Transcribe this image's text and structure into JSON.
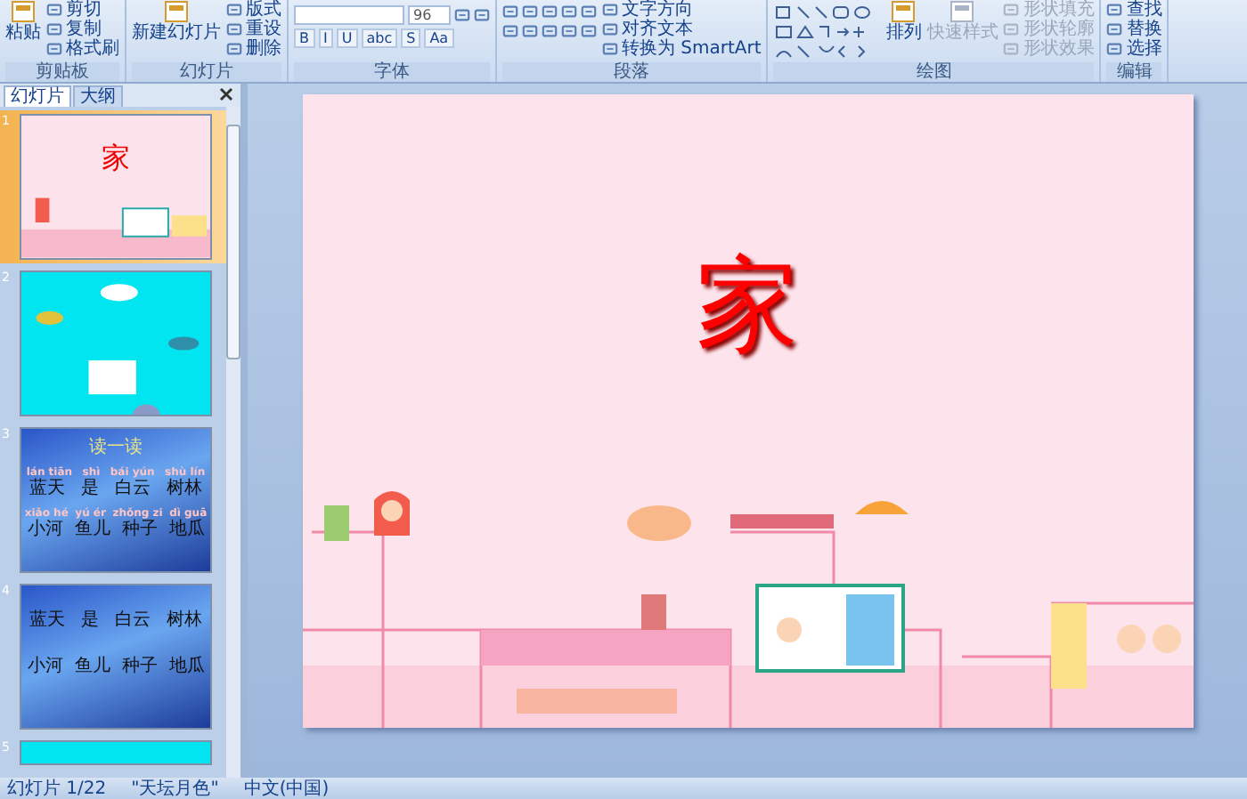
{
  "ribbon": {
    "groups": [
      {
        "kind": "clipboard",
        "label": "剪贴板",
        "large": [
          {
            "label": "粘贴",
            "disabled": false
          }
        ],
        "small": [
          {
            "label": "剪切",
            "disabled": false
          },
          {
            "label": "复制",
            "disabled": false
          },
          {
            "label": "格式刷",
            "disabled": false
          }
        ]
      },
      {
        "kind": "slides",
        "label": "幻灯片",
        "large": [
          {
            "label": "新建幻灯片",
            "disabled": false
          }
        ],
        "small": [
          {
            "label": "版式",
            "disabled": false
          },
          {
            "label": "重设",
            "disabled": false
          },
          {
            "label": "删除",
            "disabled": false
          }
        ]
      },
      {
        "kind": "font",
        "label": "字体",
        "font_size": "96",
        "format_buttons": [
          "B",
          "I",
          "U",
          "abc",
          "S",
          "Aa"
        ]
      },
      {
        "kind": "paragraph",
        "label": "段落",
        "small": [
          {
            "label": "文字方向",
            "disabled": false
          },
          {
            "label": "对齐文本",
            "disabled": false
          },
          {
            "label": "转换为 SmartArt",
            "disabled": false
          }
        ]
      },
      {
        "kind": "drawing",
        "label": "绘图",
        "large": [
          {
            "label": "排列",
            "disabled": false
          },
          {
            "label": "快速样式",
            "disabled": true
          }
        ],
        "small": [
          {
            "label": "形状填充",
            "disabled": true
          },
          {
            "label": "形状轮廓",
            "disabled": true
          },
          {
            "label": "形状效果",
            "disabled": true
          }
        ]
      },
      {
        "kind": "editing",
        "label": "编辑",
        "small": [
          {
            "label": "查找",
            "disabled": false
          },
          {
            "label": "替换",
            "disabled": false
          },
          {
            "label": "选择",
            "disabled": false
          }
        ]
      }
    ]
  },
  "panel": {
    "tabs": [
      {
        "label": "幻灯片",
        "selected": true
      },
      {
        "label": "大纲",
        "selected": false
      }
    ],
    "thumbnails": [
      {
        "number": "1",
        "selected": true,
        "kind": "title",
        "title": "家"
      },
      {
        "number": "2",
        "selected": false,
        "kind": "scene"
      },
      {
        "number": "3",
        "selected": false,
        "kind": "reading",
        "title": "读一读",
        "rows": [
          {
            "pinyin": [
              "lán tiān",
              "shì",
              "bái yún",
              "shù lín"
            ],
            "words": [
              "蓝天",
              "是",
              "白云",
              "树林"
            ]
          },
          {
            "pinyin": [
              "xiǎo hé",
              "yú ér",
              "zhǒng zi",
              "dì guā"
            ],
            "words": [
              "小河",
              "鱼儿",
              "种子",
              "地瓜"
            ]
          }
        ]
      },
      {
        "number": "4",
        "selected": false,
        "kind": "words",
        "rows": [
          {
            "words": [
              "蓝天",
              "是",
              "白云",
              "树林"
            ]
          },
          {
            "words": [
              "小河",
              "鱼儿",
              "种子",
              "地瓜"
            ]
          }
        ]
      },
      {
        "number": "5",
        "selected": false,
        "kind": "partial"
      }
    ]
  },
  "slide": {
    "title": "家"
  },
  "status_bar": {
    "items": [
      "幻灯片 1/22",
      "\"天坛月色\"",
      "中文(中国)"
    ]
  }
}
